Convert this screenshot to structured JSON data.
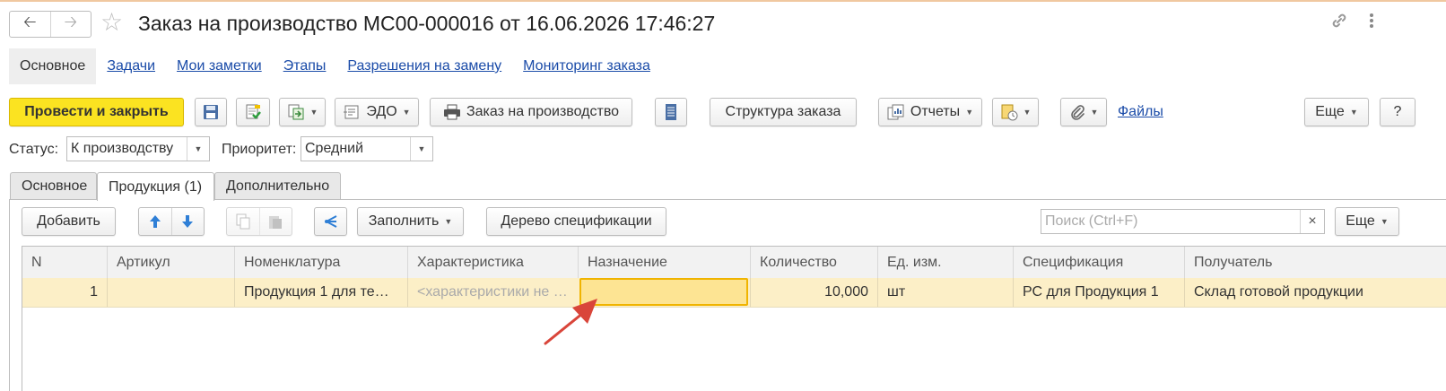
{
  "window": {
    "title": "Заказ на производство МС00-000016 от 16.06.2026 17:46:27"
  },
  "form_tabs": [
    "Основное",
    "Задачи",
    "Мои заметки",
    "Этапы",
    "Разрешения на замену",
    "Мониторинг заказа"
  ],
  "toolbar": {
    "post_close": "Провести и закрыть",
    "edo": "ЭДО",
    "print_order": "Заказ на производство",
    "order_structure": "Структура заказа",
    "reports": "Отчеты",
    "files": "Файлы",
    "more": "Еще",
    "help": "?"
  },
  "header_fields": {
    "status_label": "Статус:",
    "status_value": "К производству",
    "priority_label": "Приоритет:",
    "priority_value": "Средний"
  },
  "page_tabs": [
    "Основное",
    "Продукция (1)",
    "Дополнительно"
  ],
  "table_toolbar": {
    "add": "Добавить",
    "fill": "Заполнить",
    "spec_tree": "Дерево спецификации",
    "search_placeholder": "Поиск (Ctrl+F)",
    "clear": "×",
    "more": "Еще"
  },
  "table": {
    "columns": [
      "N",
      "Артикул",
      "Номенклатура",
      "Характеристика",
      "Назначение",
      "Количество",
      "Ед. изм.",
      "Спецификация",
      "Получатель"
    ],
    "rows": [
      [
        "1",
        "",
        "Продукция 1 для те…",
        "<характеристики не …",
        "",
        "10,000",
        "шт",
        "РС для Продукция 1",
        "Склад готовой продукции"
      ]
    ]
  },
  "colors": {
    "accent_yellow": "#fbe321",
    "row_highlight": "#fcefc7",
    "selected_cell": "#fde493",
    "link_blue": "#1a4ba8",
    "arrow_red": "#d9453a"
  }
}
